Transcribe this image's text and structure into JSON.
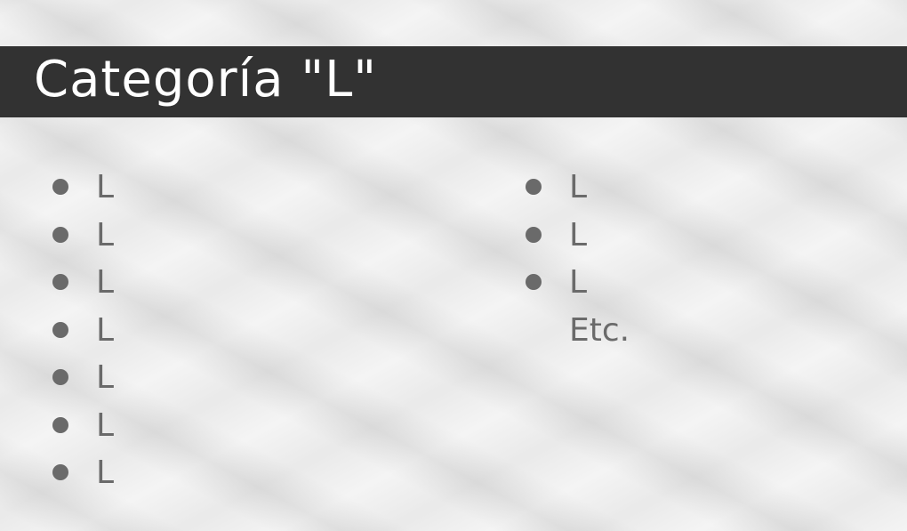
{
  "slide": {
    "title": "Categoría \"L\"",
    "left_items": [
      "L",
      "L",
      "L",
      "L",
      "L",
      "L",
      "L"
    ],
    "right_items": [
      "L",
      "L",
      "L"
    ],
    "trailing_text": "Etc."
  },
  "colors": {
    "title_bar": "#323232",
    "title_text": "#ffffff",
    "list_text": "#6a6a6a",
    "bullet": "#6a6a6a"
  },
  "icons": {
    "bullet": "filled-circle"
  }
}
